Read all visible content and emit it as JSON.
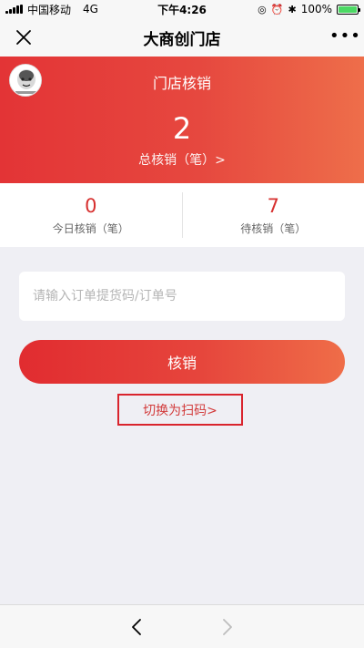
{
  "status_bar": {
    "carrier": "中国移动",
    "network": "4G",
    "time": "下午4:26",
    "battery": "100%",
    "battery_level": 1.0
  },
  "nav": {
    "title": "大商创门店",
    "more": "•••"
  },
  "header": {
    "title": "门店核销",
    "total_count": "2",
    "total_label": "总核销（笔）>"
  },
  "stats": {
    "today_value": "0",
    "today_label": "今日核销（笔）",
    "pending_value": "7",
    "pending_label": "待核销（笔）"
  },
  "form": {
    "code_value": "",
    "code_placeholder": "请输入订单提货码/订单号",
    "submit_label": "核销",
    "switch_label": "切换为扫码>"
  },
  "colors": {
    "accent": "#e33436",
    "accent_end": "#ee6e4a",
    "link_border": "#d9242d"
  },
  "icons": {
    "close": "close-icon",
    "more": "more-icon",
    "back": "chevron-left-icon",
    "forward": "chevron-right-icon"
  }
}
